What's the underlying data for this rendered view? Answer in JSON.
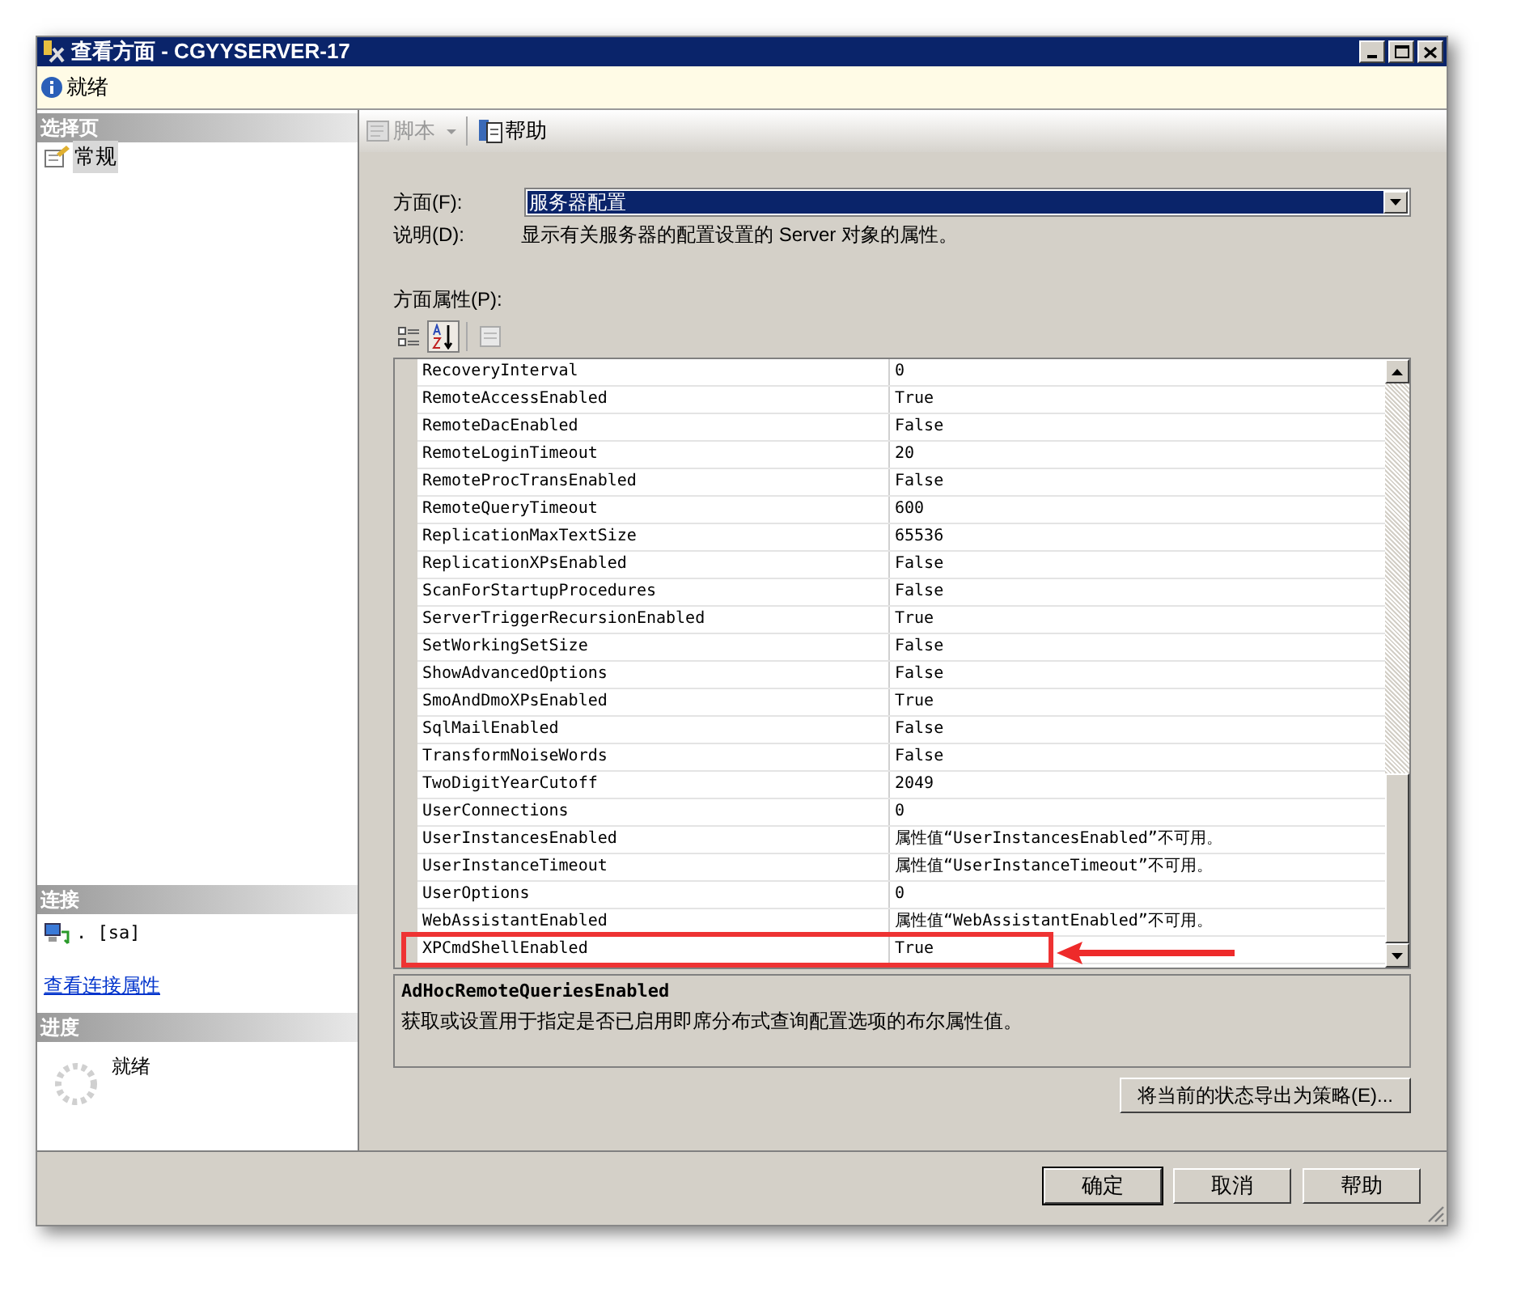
{
  "window": {
    "title": "查看方面 - CGYYSERVER-17"
  },
  "status_bar": {
    "text": "就绪"
  },
  "sidebar": {
    "header": "选择页",
    "items": [
      {
        "label": "常规",
        "selected": true
      }
    ]
  },
  "connection": {
    "header": "连接",
    "server": ". [sa]",
    "link": "查看连接属性"
  },
  "progress": {
    "header": "进度",
    "text": "就绪"
  },
  "toolbar": {
    "buttons": [
      {
        "kind": "script",
        "label": "脚本",
        "disabled": true
      },
      {
        "kind": "help",
        "label": "帮助",
        "disabled": false
      }
    ]
  },
  "facet": {
    "label": "方面(F):",
    "value": "服务器配置"
  },
  "description": {
    "label": "说明(D):",
    "text": "显示有关服务器的配置设置的 Server 对象的属性。"
  },
  "properties_label": "方面属性(P):",
  "sort_buttons": [
    {
      "kind": "categorized",
      "selected": false
    },
    {
      "kind": "alphabetical",
      "selected": true
    },
    {
      "kind": "pages",
      "selected": false
    }
  ],
  "properties": [
    {
      "name": "RecoveryInterval",
      "value": "0",
      "highlighted": false
    },
    {
      "name": "RemoteAccessEnabled",
      "value": "True",
      "highlighted": false
    },
    {
      "name": "RemoteDacEnabled",
      "value": "False",
      "highlighted": false
    },
    {
      "name": "RemoteLoginTimeout",
      "value": "20",
      "highlighted": false
    },
    {
      "name": "RemoteProcTransEnabled",
      "value": "False",
      "highlighted": false
    },
    {
      "name": "RemoteQueryTimeout",
      "value": "600",
      "highlighted": false
    },
    {
      "name": "ReplicationMaxTextSize",
      "value": "65536",
      "highlighted": false
    },
    {
      "name": "ReplicationXPsEnabled",
      "value": "False",
      "highlighted": false
    },
    {
      "name": "ScanForStartupProcedures",
      "value": "False",
      "highlighted": false
    },
    {
      "name": "ServerTriggerRecursionEnabled",
      "value": "True",
      "highlighted": false
    },
    {
      "name": "SetWorkingSetSize",
      "value": "False",
      "highlighted": false
    },
    {
      "name": "ShowAdvancedOptions",
      "value": "False",
      "highlighted": false
    },
    {
      "name": "SmoAndDmoXPsEnabled",
      "value": "True",
      "highlighted": false
    },
    {
      "name": "SqlMailEnabled",
      "value": "False",
      "highlighted": false
    },
    {
      "name": "TransformNoiseWords",
      "value": "False",
      "highlighted": false
    },
    {
      "name": "TwoDigitYearCutoff",
      "value": "2049",
      "highlighted": false
    },
    {
      "name": "UserConnections",
      "value": "0",
      "highlighted": false
    },
    {
      "name": "UserInstancesEnabled",
      "value": "属性值“UserInstancesEnabled”不可用。",
      "highlighted": false
    },
    {
      "name": "UserInstanceTimeout",
      "value": "属性值“UserInstanceTimeout”不可用。",
      "highlighted": false
    },
    {
      "name": "UserOptions",
      "value": "0",
      "highlighted": false
    },
    {
      "name": "WebAssistantEnabled",
      "value": "属性值“WebAssistantEnabled”不可用。",
      "highlighted": false
    },
    {
      "name": "XPCmdShellEnabled",
      "value": "True",
      "highlighted": true
    }
  ],
  "property_help": {
    "title": "AdHocRemoteQueriesEnabled",
    "text": "获取或设置用于指定是否已启用即席分布式查询配置选项的布尔属性值。"
  },
  "export_button": "将当前的状态导出为策略(E)...",
  "buttons": [
    {
      "label": "确定",
      "default": true
    },
    {
      "label": "取消",
      "default": false
    },
    {
      "label": "帮助",
      "default": false
    }
  ]
}
